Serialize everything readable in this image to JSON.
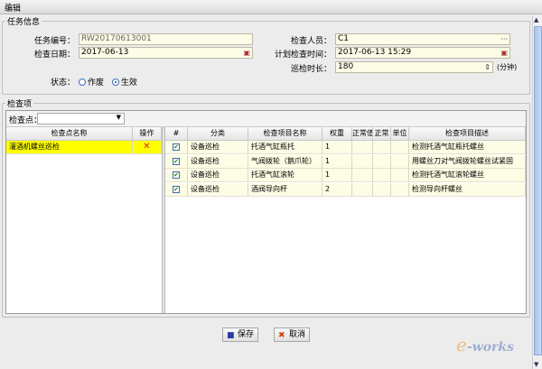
{
  "window": {
    "title": "编辑"
  },
  "task_info": {
    "legend": "任务信息",
    "task_no": {
      "label": "任务编号：",
      "value": "RW20170613001"
    },
    "check_date": {
      "label": "检查日期：",
      "value": "2017-06-13"
    },
    "inspector": {
      "label": "检查人员：",
      "value": "C1"
    },
    "planned_time": {
      "label": "计划检查时间：",
      "value": "2017-06-13 15:29"
    },
    "duration": {
      "label": "巡检时长：",
      "value": "180",
      "unit": "(分钟)"
    },
    "status": {
      "label": "状态：",
      "options": [
        "作废",
        "生效"
      ],
      "selected": "生效"
    }
  },
  "check_items": {
    "legend": "检查项",
    "checkpoint_label": "检查点：",
    "checkpoint_value": "",
    "left_grid": {
      "headers": [
        "检查点名称",
        "操作"
      ],
      "rows": [
        {
          "name": "灌酒机螺丝巡检",
          "action": "✕"
        }
      ]
    },
    "right_grid": {
      "headers": [
        "#",
        "分类",
        "检查项目名称",
        "权重",
        "正常值",
        "正常",
        "单位",
        "检查项目描述"
      ],
      "rows": [
        {
          "checked": true,
          "category": "设备巡检",
          "name": "托酒气缸瓶托",
          "weight": "1",
          "normal1": "",
          "normal2": "",
          "unit": "",
          "desc": "检测托酒气缸瓶托螺丝"
        },
        {
          "checked": true,
          "category": "设备巡检",
          "name": "气阀拨轮（鹅爪轮）",
          "weight": "1",
          "normal1": "",
          "normal2": "",
          "unit": "",
          "desc": "用螺丝刀对气阀拨轮螺丝试紧固"
        },
        {
          "checked": true,
          "category": "设备巡检",
          "name": "托酒气缸滚轮",
          "weight": "1",
          "normal1": "",
          "normal2": "",
          "unit": "",
          "desc": "检测托酒气缸滚轮螺丝"
        },
        {
          "checked": true,
          "category": "设备巡检",
          "name": "酒阀导向杆",
          "weight": "2",
          "normal1": "",
          "normal2": "",
          "unit": "",
          "desc": "检测导向杆螺丝"
        }
      ]
    }
  },
  "buttons": {
    "save": "保存",
    "cancel": "取消"
  },
  "watermark": "e-works"
}
